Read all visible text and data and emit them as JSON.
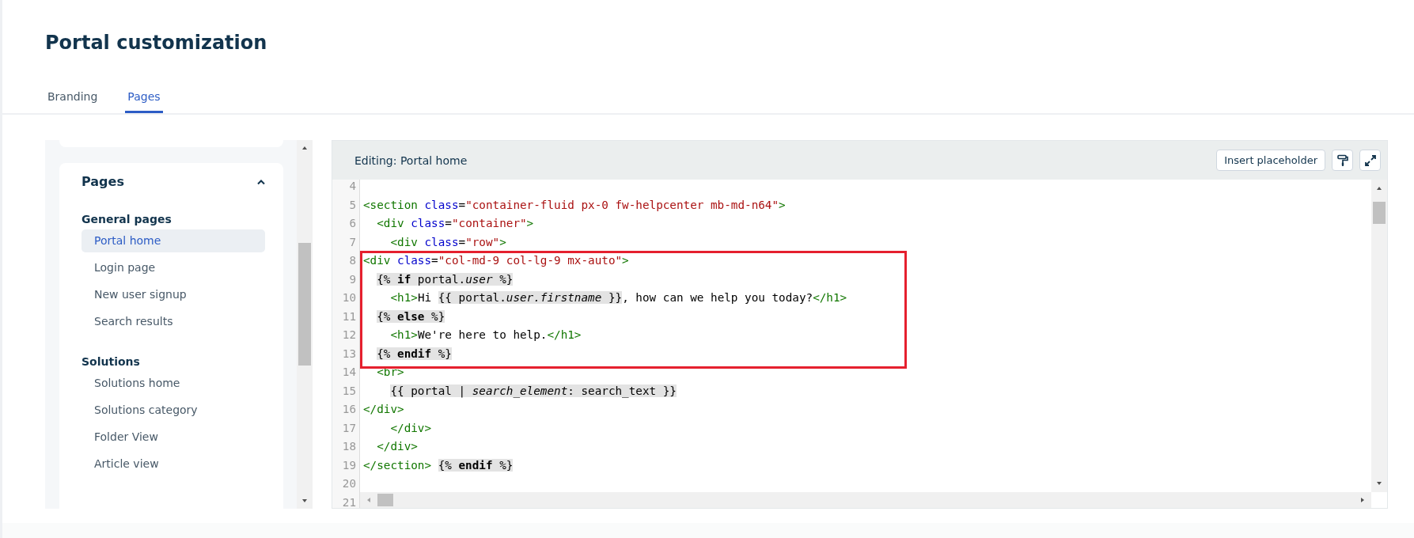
{
  "page": {
    "title": "Portal customization"
  },
  "tabs": [
    {
      "label": "Branding",
      "selected": false
    },
    {
      "label": "Pages",
      "selected": true
    }
  ],
  "sidebar": {
    "section": {
      "title": "Pages",
      "expanded": true,
      "groups": [
        {
          "title": "General pages",
          "items": [
            {
              "label": "Portal home",
              "selected": true
            },
            {
              "label": "Login page",
              "selected": false
            },
            {
              "label": "New user signup",
              "selected": false
            },
            {
              "label": "Search results",
              "selected": false
            }
          ]
        },
        {
          "title": "Solutions",
          "items": [
            {
              "label": "Solutions home",
              "selected": false
            },
            {
              "label": "Solutions category",
              "selected": false
            },
            {
              "label": "Folder View",
              "selected": false
            },
            {
              "label": "Article view",
              "selected": false
            }
          ]
        }
      ]
    }
  },
  "editor": {
    "title": "Editing: Portal home",
    "insert_button": "Insert placeholder",
    "blocks": [
      {
        "highlighted": false,
        "lines": [
          {
            "number": "4"
          },
          {
            "number": "5",
            "tokens": [
              {
                "kind": "tag",
                "text": "<section"
              },
              {
                "kind": "attr",
                "text": " class"
              },
              {
                "kind": "text",
                "text": "="
              },
              {
                "kind": "string",
                "text": "\"container-fluid px-0 fw-helpcenter mb-md-n64\""
              },
              {
                "kind": "tag",
                "text": ">"
              }
            ]
          },
          {
            "number": "6",
            "tokens": [
              {
                "kind": "tag",
                "text": "  <div"
              },
              {
                "kind": "attr",
                "text": " class"
              },
              {
                "kind": "text",
                "text": "="
              },
              {
                "kind": "string",
                "text": "\"container\""
              },
              {
                "kind": "tag",
                "text": ">"
              }
            ]
          },
          {
            "number": "7",
            "tokens": [
              {
                "kind": "tag",
                "text": "    <div"
              },
              {
                "kind": "attr",
                "text": " class"
              },
              {
                "kind": "text",
                "text": "="
              },
              {
                "kind": "string",
                "text": "\"row\""
              },
              {
                "kind": "tag",
                "text": ">"
              }
            ]
          }
        ]
      },
      {
        "highlighted": true,
        "lines": [
          {
            "number": "8",
            "tokens": [
              {
                "kind": "tag",
                "text": "<div"
              },
              {
                "kind": "attr",
                "text": " class"
              },
              {
                "kind": "text",
                "text": "="
              },
              {
                "kind": "string",
                "text": "\"col-md-9 col-lg-9 mx-auto\""
              },
              {
                "kind": "tag",
                "text": ">"
              }
            ]
          },
          {
            "number": "9",
            "tokens": [
              {
                "kind": "liquid",
                "text": "  {% **if** portal.*user* %}"
              }
            ]
          },
          {
            "number": "10",
            "tokens": [
              {
                "kind": "tag",
                "text": "    <h1>"
              },
              {
                "kind": "text",
                "text": "Hi "
              },
              {
                "kind": "liquid",
                "text": "{{ portal.*user.firstname* }}"
              },
              {
                "kind": "text",
                "text": ", how can we help you today?"
              },
              {
                "kind": "tag",
                "text": "</h1>"
              }
            ]
          },
          {
            "number": "11",
            "tokens": [
              {
                "kind": "liquid",
                "text": "  {% **else** %}"
              }
            ]
          },
          {
            "number": "12",
            "tokens": [
              {
                "kind": "tag",
                "text": "    <h1>"
              },
              {
                "kind": "text",
                "text": "We're here to help."
              },
              {
                "kind": "tag",
                "text": "</h1>"
              }
            ]
          },
          {
            "number": "13",
            "tokens": [
              {
                "kind": "liquid",
                "text": "  {% **endif** %}"
              }
            ]
          }
        ]
      },
      {
        "highlighted": false,
        "lines": [
          {
            "number": "14",
            "tokens": [
              {
                "kind": "tag",
                "text": "  <br>"
              }
            ]
          },
          {
            "number": "15",
            "tokens": [
              {
                "kind": "liquid",
                "text": "    {{ portal | *search_element*: search_text }}"
              }
            ]
          },
          {
            "number": "16",
            "tokens": [
              {
                "kind": "tag",
                "text": "</div>"
              }
            ]
          },
          {
            "number": "17",
            "tokens": [
              {
                "kind": "tag",
                "text": "    </div>"
              }
            ]
          },
          {
            "number": "18",
            "tokens": [
              {
                "kind": "tag",
                "text": "  </div>"
              }
            ]
          },
          {
            "number": "19",
            "tokens": [
              {
                "kind": "tag",
                "text": "</section> "
              },
              {
                "kind": "liquid",
                "text": "{% **endif** %}"
              }
            ]
          },
          {
            "number": "20"
          },
          {
            "number": "21"
          }
        ]
      }
    ]
  }
}
